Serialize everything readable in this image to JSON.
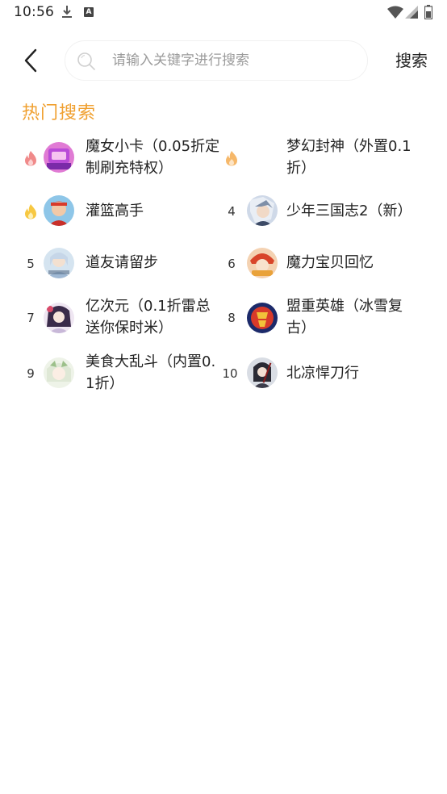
{
  "status_bar": {
    "time": "10:56",
    "icons": [
      "download-icon",
      "a-notification-icon",
      "wifi-icon",
      "signal-icon",
      "battery-icon"
    ]
  },
  "header": {
    "back_icon": "chevron-left-icon",
    "search": {
      "placeholder": "请输入关键字进行搜索",
      "value": ""
    },
    "search_button": "搜索"
  },
  "hot_search": {
    "title": "热门搜索",
    "title_color": "#f0a030",
    "items": [
      {
        "rank": "",
        "badge": "fire-red-icon",
        "name": "魔女小卡（0.05折定制刷充特权）"
      },
      {
        "rank": "",
        "badge": "fire-orange-icon",
        "name": "梦幻封神（外置0.1折）"
      },
      {
        "rank": "",
        "badge": "fire-yellow-icon",
        "name": "灌篮高手"
      },
      {
        "rank": "4",
        "badge": "",
        "name": "少年三国志2（新）"
      },
      {
        "rank": "5",
        "badge": "",
        "name": "道友请留步"
      },
      {
        "rank": "6",
        "badge": "",
        "name": "魔力宝贝回忆"
      },
      {
        "rank": "7",
        "badge": "",
        "name": "亿次元（0.1折雷总送你保时米）"
      },
      {
        "rank": "8",
        "badge": "",
        "name": "盟重英雄（冰雪复古）"
      },
      {
        "rank": "9",
        "badge": "",
        "name": "美食大乱斗（内置0.1折）"
      },
      {
        "rank": "10",
        "badge": "",
        "name": "北凉悍刀行"
      }
    ]
  }
}
